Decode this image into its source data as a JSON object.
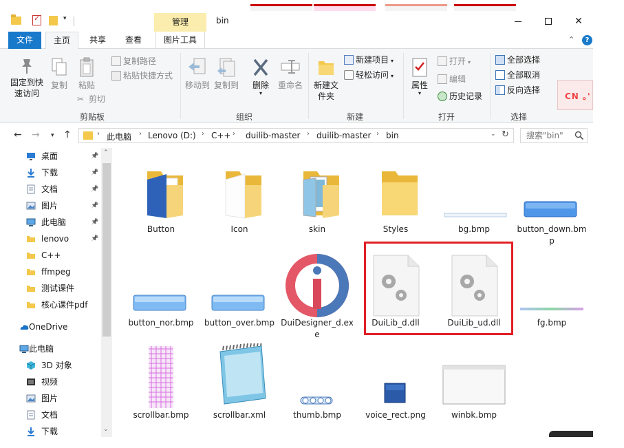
{
  "window": {
    "title": "bin",
    "context_tab": "管理",
    "min_glyph": "—",
    "max_glyph": "☐",
    "close_glyph": "✕"
  },
  "ribbon_tabs": {
    "file": "文件",
    "home": "主页",
    "share": "共享",
    "view": "查看",
    "picture_tools": "图片工具"
  },
  "ribbon": {
    "clipboard": {
      "label": "剪贴板",
      "pin_quick": "固定到快速访问",
      "copy": "复制",
      "paste": "粘贴",
      "copy_path": "复制路径",
      "paste_shortcut": "粘贴快捷方式",
      "cut": "剪切"
    },
    "organize": {
      "label": "组织",
      "move_to": "移动到",
      "copy_to": "复制到",
      "delete": "删除",
      "rename": "重命名"
    },
    "new": {
      "label": "新建",
      "new_folder": "新建文件夹",
      "new_item": "新建项目",
      "easy_access": "轻松访问"
    },
    "open": {
      "label": "打开",
      "properties": "属性",
      "open": "打开",
      "edit": "编辑",
      "history": "历史记录"
    },
    "select": {
      "label": "选择",
      "select_all": "全部选择",
      "select_none": "全部取消",
      "invert": "反向选择"
    }
  },
  "address": {
    "crumbs": [
      "此电脑",
      "Lenovo (D:)",
      "C++",
      "duilib-master",
      "duilib-master",
      "bin"
    ],
    "search_placeholder": "搜索\"bin\""
  },
  "nav": [
    {
      "label": "桌面",
      "icon": "desktop-icon",
      "pinned": true
    },
    {
      "label": "下载",
      "icon": "download-icon",
      "pinned": true
    },
    {
      "label": "文档",
      "icon": "document-icon",
      "pinned": true
    },
    {
      "label": "图片",
      "icon": "picture-icon",
      "pinned": true
    },
    {
      "label": "此电脑",
      "icon": "computer-icon",
      "pinned": true
    },
    {
      "label": "lenovo",
      "icon": "folder-icon",
      "pinned": true
    },
    {
      "label": "C++",
      "icon": "folder-icon",
      "pinned": false
    },
    {
      "label": "ffmpeg",
      "icon": "folder-icon",
      "pinned": false
    },
    {
      "label": "测试课件",
      "icon": "folder-icon",
      "pinned": false
    },
    {
      "label": "核心课件pdf",
      "icon": "folder-icon",
      "pinned": false
    },
    {
      "label": "OneDrive",
      "icon": "onedrive-icon",
      "pinned": false
    },
    {
      "label": "此电脑",
      "icon": "computer-icon",
      "pinned": false
    },
    {
      "label": "3D 对象",
      "icon": "3d-objects-icon",
      "pinned": false
    },
    {
      "label": "视频",
      "icon": "video-icon",
      "pinned": false
    },
    {
      "label": "图片",
      "icon": "picture-icon",
      "pinned": false
    },
    {
      "label": "文档",
      "icon": "document-icon",
      "pinned": false
    },
    {
      "label": "下载",
      "icon": "download-icon",
      "pinned": false
    }
  ],
  "files": [
    {
      "name": "Button",
      "type": "folder-blue"
    },
    {
      "name": "Icon",
      "type": "folder-white"
    },
    {
      "name": "skin",
      "type": "folder-pics"
    },
    {
      "name": "Styles",
      "type": "folder-plain"
    },
    {
      "name": "bg.bmp",
      "type": "bmp-bg"
    },
    {
      "name": "button_down.bmp",
      "type": "bmp-button-down"
    },
    {
      "name": "button_nor.bmp",
      "type": "bmp-button"
    },
    {
      "name": "button_over.bmp",
      "type": "bmp-button"
    },
    {
      "name": "DuiDesigner_d.exe",
      "type": "exe-duidesigner"
    },
    {
      "name": "DuiLib_d.dll",
      "type": "dll"
    },
    {
      "name": "DuiLib_ud.dll",
      "type": "dll"
    },
    {
      "name": "fg.bmp",
      "type": "bmp-fg"
    },
    {
      "name": "scrollbar.bmp",
      "type": "bmp-scrollbar"
    },
    {
      "name": "scrollbar.xml",
      "type": "xml-notepad"
    },
    {
      "name": "thumb.bmp",
      "type": "bmp-thumb"
    },
    {
      "name": "voice_rect.png",
      "type": "png-voice"
    },
    {
      "name": "winbk.bmp",
      "type": "bmp-winbk"
    }
  ],
  "decor": {
    "cn_badge": "CN ｡'"
  }
}
